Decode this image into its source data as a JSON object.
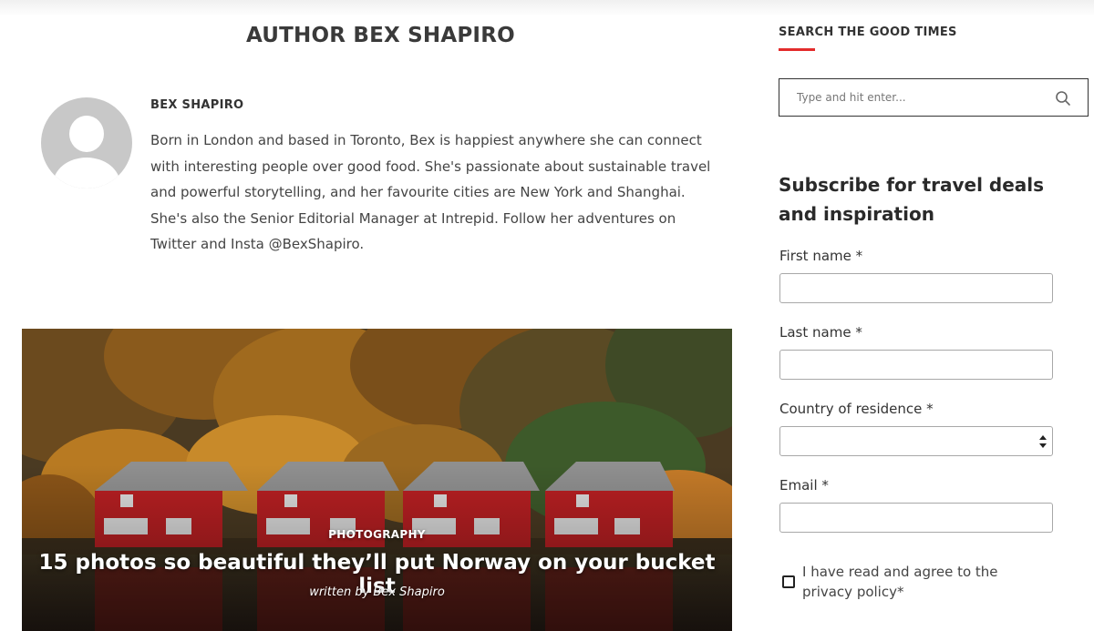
{
  "main": {
    "page_title": "AUTHOR BEX SHAPIRO",
    "author_name": "BEX SHAPIRO",
    "author_bio": "Born in London and based in Toronto, Bex is happiest anywhere she can connect with interesting people over good food. She's passionate about sustainable travel and powerful storytelling, and her favourite cities are New York and Shanghai. She's also the Senior Editorial Manager at Intrepid. Follow her adventures on Twitter and Insta @BexShapiro.",
    "feature": {
      "category": "PHOTOGRAPHY",
      "title": "15 photos so beautiful they’ll put Norway on your bucket list",
      "byline": "written by Bex Shapiro"
    }
  },
  "sidebar": {
    "search_heading": "SEARCH THE GOOD TIMES",
    "search_placeholder": "Type and hit enter...",
    "subscribe_title": "Subscribe for travel deals and inspiration",
    "fields": {
      "first_name": "First name *",
      "last_name": "Last name *",
      "country": "Country of residence *",
      "email": "Email *"
    },
    "consent_text": "I have read and agree to the privacy policy*"
  },
  "colors": {
    "accent": "#e32b2b",
    "house_red": "#b81f22"
  },
  "icons": [
    "avatar-placeholder-icon",
    "search-icon",
    "select-arrows-icon"
  ]
}
